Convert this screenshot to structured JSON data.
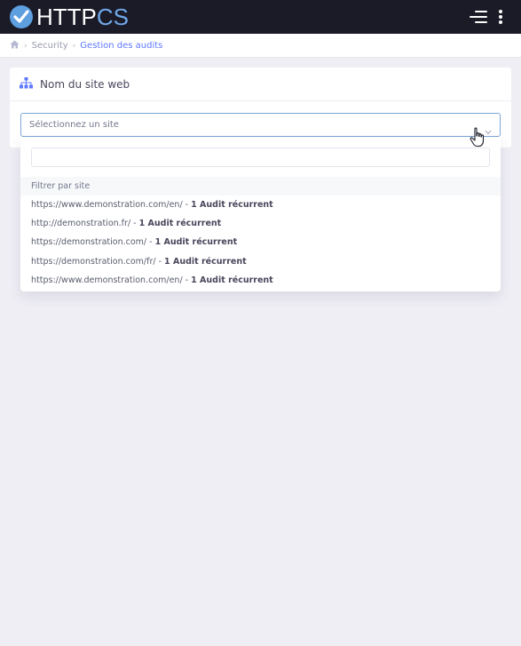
{
  "brand": {
    "prefix": "HTTP",
    "suffix": "CS",
    "accent": "#6fa8e8",
    "badge_color": "#5e9fe0"
  },
  "topbar": {
    "menu_icon": "hamburger-menu-icon",
    "more_icon": "vertical-dots-icon"
  },
  "breadcrumb": {
    "home_icon": "home-icon",
    "items": [
      "Security",
      "Gestion des audits"
    ]
  },
  "card": {
    "icon": "sitemap-icon",
    "title": "Nom du site web"
  },
  "site_select": {
    "placeholder": "Sélectionnez un site",
    "search_value": "",
    "group_label": "Filtrer par site",
    "options": [
      {
        "url": "https://www.demonstration.com/en/",
        "separator": " - ",
        "audit": "1 Audit récurrent"
      },
      {
        "url": "http://demonstration.fr/",
        "separator": " - ",
        "audit": "1 Audit récurrent"
      },
      {
        "url": "https://demonstration.com/",
        "separator": " - ",
        "audit": "1 Audit récurrent"
      },
      {
        "url": "https://demonstration.com/fr/",
        "separator": " - ",
        "audit": "1 Audit récurrent"
      },
      {
        "url": "https://www.demonstration.com/en/",
        "separator": " - ",
        "audit": "1 Audit récurrent"
      }
    ]
  }
}
